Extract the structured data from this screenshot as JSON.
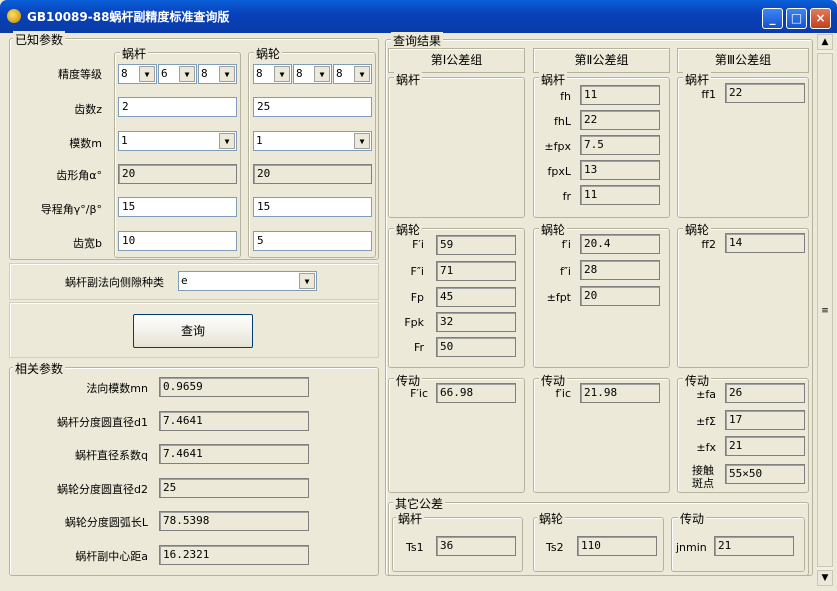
{
  "window": {
    "title": "GB10089-88蜗杆副精度标准查询版",
    "btn_min": "_",
    "btn_max": "□",
    "btn_close": "×"
  },
  "known": {
    "title": "已知参数",
    "col_worm": "蜗杆",
    "col_wheel": "蜗轮",
    "precision_label": "精度等级",
    "worm_grades": [
      "8",
      "6",
      "8"
    ],
    "wheel_grades": [
      "8",
      "8",
      "8"
    ],
    "teeth_label": "齿数z",
    "teeth_worm": "2",
    "teeth_wheel": "25",
    "module_label": "模数m",
    "module_worm": "1",
    "module_wheel": "1",
    "profile_angle_label": "齿形角α°",
    "profile_angle_worm": "20",
    "profile_angle_wheel": "20",
    "lead_angle_label": "导程角γ°/β°",
    "lead_angle_worm": "15",
    "lead_angle_wheel": "15",
    "width_label": "齿宽b",
    "width_worm": "10",
    "width_wheel": "5",
    "backlash_label": "蜗杆副法向侧隙种类",
    "backlash_value": "e",
    "query_button": "查询"
  },
  "related": {
    "title": "相关参数",
    "mn_label": "法向模数mn",
    "mn": "0.9659",
    "d1_label": "蜗杆分度圆直径d1",
    "d1": "7.4641",
    "q_label": "蜗杆直径系数q",
    "q": "7.4641",
    "d2_label": "蜗轮分度圆直径d2",
    "d2": "25",
    "L_label": "蜗轮分度圆弧长L",
    "L": "78.5398",
    "a_label": "蜗杆副中心距a",
    "a": "16.2321"
  },
  "results": {
    "title": "查询结果",
    "g1": {
      "header": "第Ⅰ公差组",
      "worm_title": "蜗杆",
      "wheel_title": "蜗轮",
      "drive_title": "传动",
      "wheel": [
        {
          "label": "F′i",
          "value": "59"
        },
        {
          "label": "F″i",
          "value": "71"
        },
        {
          "label": "Fp",
          "value": "45"
        },
        {
          "label": "Fpk",
          "value": "32"
        },
        {
          "label": "Fr",
          "value": "50"
        }
      ],
      "drive": [
        {
          "label": "F′ic",
          "value": "66.98"
        }
      ]
    },
    "g2": {
      "header": "第Ⅱ公差组",
      "worm_title": "蜗杆",
      "wheel_title": "蜗轮",
      "drive_title": "传动",
      "worm": [
        {
          "label": "fh",
          "value": "11"
        },
        {
          "label": "fhL",
          "value": "22"
        },
        {
          "label": "±fpx",
          "value": "7.5"
        },
        {
          "label": "fpxL",
          "value": "13"
        },
        {
          "label": "fr",
          "value": "11"
        }
      ],
      "wheel": [
        {
          "label": "f′i",
          "value": "20.4"
        },
        {
          "label": "f″i",
          "value": "28"
        },
        {
          "label": "±fpt",
          "value": "20"
        }
      ],
      "drive": [
        {
          "label": "f′ic",
          "value": "21.98"
        }
      ]
    },
    "g3": {
      "header": "第Ⅲ公差组",
      "worm_title": "蜗杆",
      "wheel_title": "蜗轮",
      "drive_title": "传动",
      "worm": [
        {
          "label": "ff1",
          "value": "22"
        }
      ],
      "wheel": [
        {
          "label": "ff2",
          "value": "14"
        }
      ],
      "drive": [
        {
          "label": "±fa",
          "value": "26"
        },
        {
          "label": "±fΣ",
          "value": "17"
        },
        {
          "label": "±fx",
          "value": "21"
        },
        {
          "label": "接触",
          "label2": "斑点",
          "value": "55×50"
        }
      ]
    },
    "other": {
      "title": "其它公差",
      "worm_title": "蜗杆",
      "wheel_title": "蜗轮",
      "drive_title": "传动",
      "ts1_label": "Ts1",
      "ts1": "36",
      "ts2_label": "Ts2",
      "ts2": "110",
      "jnmin_label": "jnmin",
      "jnmin": "21"
    }
  },
  "scrollbar": {
    "up": "▲",
    "down": "▼"
  }
}
